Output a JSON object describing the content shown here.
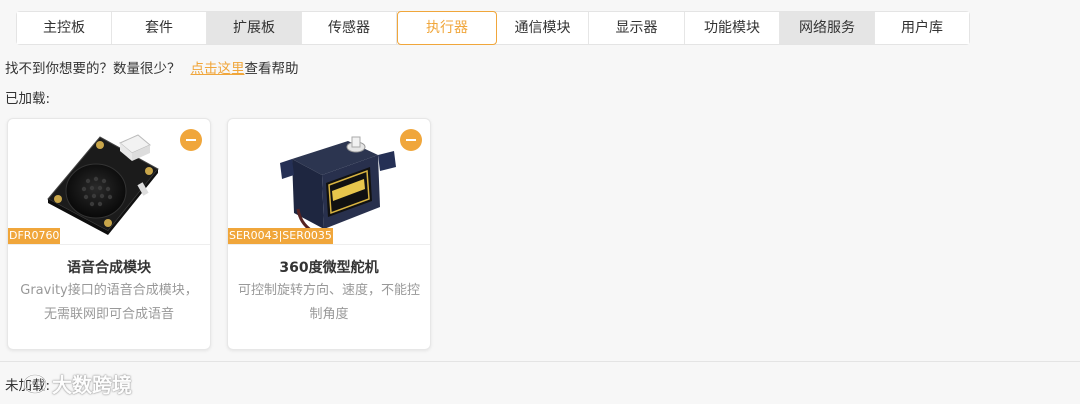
{
  "tabs": [
    {
      "label": "主控板",
      "state": "normal"
    },
    {
      "label": "套件",
      "state": "normal"
    },
    {
      "label": "扩展板",
      "state": "gray"
    },
    {
      "label": "传感器",
      "state": "normal"
    },
    {
      "label": "执行器",
      "state": "active"
    },
    {
      "label": "通信模块",
      "state": "normal"
    },
    {
      "label": "显示器",
      "state": "normal"
    },
    {
      "label": "功能模块",
      "state": "normal"
    },
    {
      "label": "网络服务",
      "state": "gray"
    },
    {
      "label": "用户库",
      "state": "normal"
    }
  ],
  "help": {
    "prefix": "找不到你想要的？数量很少？",
    "link": "点击这里",
    "suffix": "查看帮助"
  },
  "loaded_title": "已加载:",
  "cards": [
    {
      "sku": "DFR0760",
      "name": "语音合成模块",
      "desc": "Gravity接口的语音合成模块，无需联网即可合成语音",
      "image": "speech-module-board"
    },
    {
      "sku": "SER0043|SER0035",
      "name": "360度微型舵机",
      "desc": "可控制旋转方向、速度，不能控制角度",
      "image": "micro-servo"
    }
  ],
  "unloaded_title": "未加载:",
  "watermark": "大数跨境",
  "colors": {
    "accent": "#f0a63b",
    "tab_gray": "#e5e5e5"
  }
}
